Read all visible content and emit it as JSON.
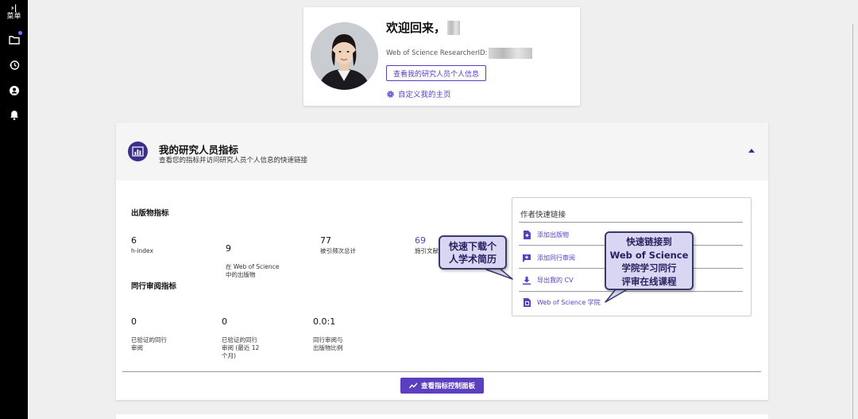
{
  "nav": {
    "menu_label": "菜单",
    "menu_chevron": "›|",
    "items": [
      {
        "icon": "folder-icon",
        "badge": true
      },
      {
        "icon": "history-icon"
      },
      {
        "icon": "account-icon"
      },
      {
        "icon": "bell-icon"
      }
    ]
  },
  "profile": {
    "welcome": "欢迎回来，",
    "researcher_id_label": "Web of Science ResearcherID:",
    "view_info_button": "查看我的研究人员个人信息",
    "customize_link": "自定义我的主页"
  },
  "metrics": {
    "title": "我的研究人员指标",
    "subtitle": "查看您的指标并访问研究人员个人信息的快速链接",
    "publication_section": "出版物指标",
    "publication_metrics": [
      {
        "value": "6",
        "label": "h-index"
      },
      {
        "value": "9",
        "label": "在 Web of Science\n中的出版物"
      },
      {
        "value": "77",
        "label": "被引频次总计"
      },
      {
        "value": "69",
        "label": "施引文献"
      }
    ],
    "peer_review_section": "同行审阅指标",
    "peer_review_metrics": [
      {
        "value": "0",
        "label": "已验证的同行\n审阅"
      },
      {
        "value": "0",
        "label": "已验证的同行\n审阅 (最近 12\n个月)"
      },
      {
        "value": "0.0:1",
        "label": "同行审阅与\n出版物比例"
      }
    ],
    "dashboard_button": "查看指标控制面板",
    "colors": {
      "accent": "#5b3fbf",
      "dark_accent": "#3a2e8a"
    }
  },
  "quick_links": {
    "title": "作者快速链接",
    "items": [
      {
        "label": "添加出版物",
        "icon": "add-document-icon"
      },
      {
        "label": "添加同行审阅",
        "icon": "add-comment-icon"
      },
      {
        "label": "导出我的 CV",
        "icon": "download-icon"
      },
      {
        "label": "Web of Science 学院",
        "icon": "academy-icon"
      }
    ]
  },
  "callouts": {
    "cv_note": "快速下载个\n人学术简历",
    "academy_note": "快速链接到\nWeb of Science\n学院学习同行\n评审在线课程"
  }
}
